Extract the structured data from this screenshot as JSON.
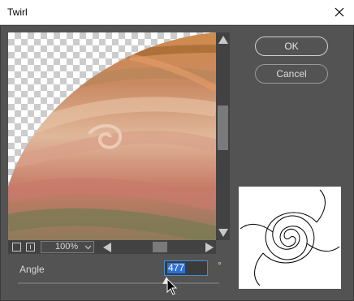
{
  "window": {
    "title": "Twirl"
  },
  "buttons": {
    "ok": "OK",
    "cancel": "Cancel"
  },
  "preview": {
    "zoom": "100%"
  },
  "angle": {
    "label": "Angle",
    "value": "477",
    "unit": "°"
  },
  "icons": [
    "close-icon",
    "scroll-up-icon",
    "scroll-down-icon",
    "scroll-left-icon",
    "scroll-right-icon",
    "fit-icon",
    "actual-size-icon",
    "chevron-down-icon",
    "cursor-icon",
    "twirl-thumbnail-icon"
  ]
}
